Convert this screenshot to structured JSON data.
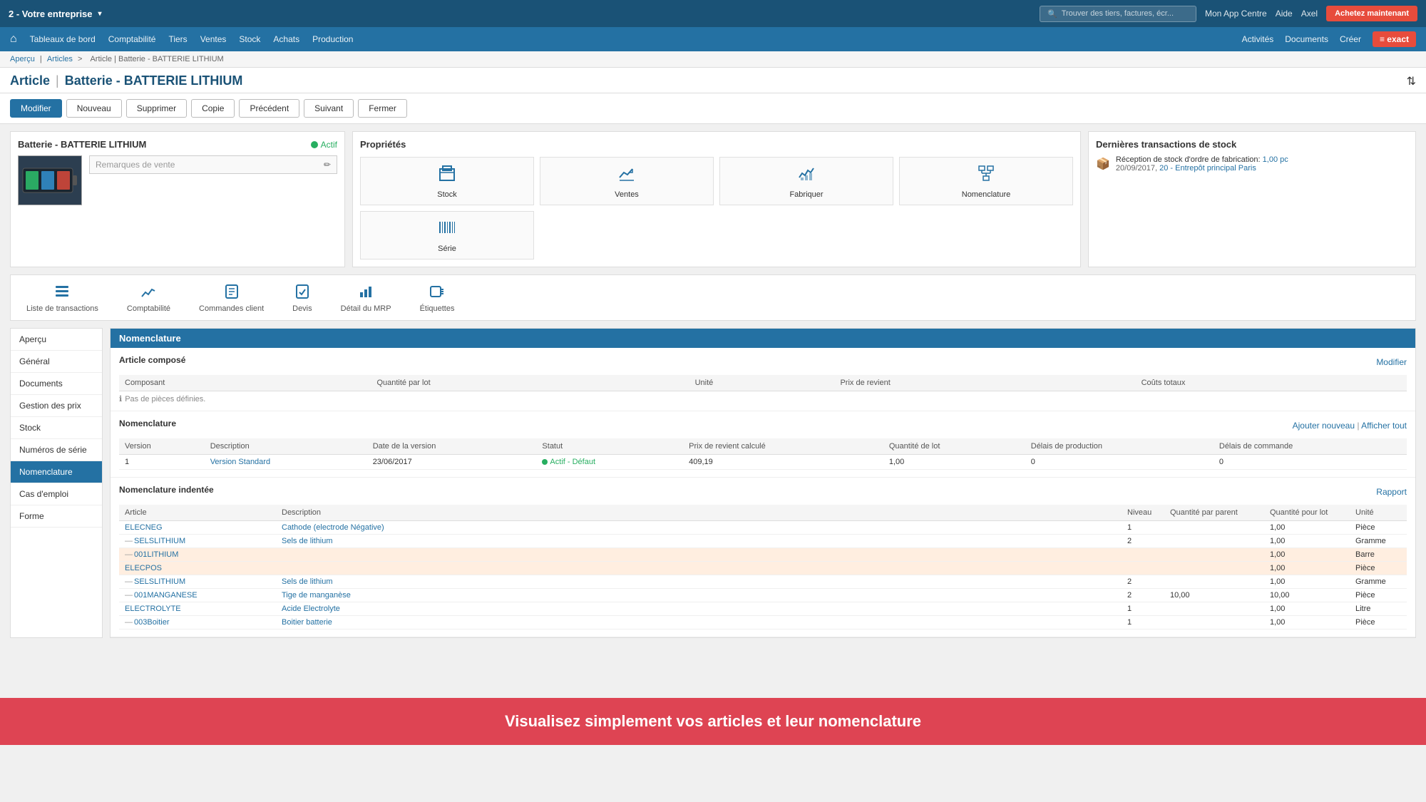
{
  "topbar": {
    "company": "2 - Votre entreprise",
    "search_placeholder": "Trouver des tiers, factures, écr...",
    "app_centre": "Mon App Centre",
    "aide": "Aide",
    "user": "Axel",
    "buy_btn": "Achetez maintenant"
  },
  "navbar": {
    "home_icon": "⌂",
    "items": [
      "Tableaux de bord",
      "Comptabilité",
      "Tiers",
      "Ventes",
      "Stock",
      "Achats",
      "Production"
    ],
    "right_links": [
      "Activités",
      "Documents",
      "Créer"
    ]
  },
  "breadcrumb": {
    "parts": [
      "Aperçu",
      "Articles",
      "Article | Batterie - BATTERIE LITHIUM"
    ]
  },
  "page": {
    "category": "Article",
    "title": "Batterie - BATTERIE LITHIUM",
    "filter_icon": "⇅"
  },
  "actions": {
    "modifier": "Modifier",
    "nouveau": "Nouveau",
    "supprimer": "Supprimer",
    "copie": "Copie",
    "precedent": "Précédent",
    "suivant": "Suivant",
    "fermer": "Fermer"
  },
  "product_panel": {
    "title": "Batterie - BATTERIE LITHIUM",
    "active_label": "Actif",
    "remarks_placeholder": "Remarques de vente"
  },
  "props_panel": {
    "title": "Propriétés",
    "items": [
      {
        "icon": "📦",
        "label": "Stock"
      },
      {
        "icon": "💰",
        "label": "Ventes"
      },
      {
        "icon": "🔧",
        "label": "Fabriquer"
      },
      {
        "icon": "📋",
        "label": "Nomenclature"
      },
      {
        "icon": "▦",
        "label": "Série"
      }
    ]
  },
  "transactions_panel": {
    "title": "Dernières transactions de stock",
    "transaction": {
      "description": "Réception de stock d'ordre de fabrication:",
      "quantity": "1,00 pc",
      "date": "20/09/2017,",
      "location_link": "20 - Entrepôt principal Paris"
    }
  },
  "tabs": [
    {
      "icon": "☰",
      "label": "Liste de transactions"
    },
    {
      "icon": "📊",
      "label": "Comptabilité"
    },
    {
      "icon": "📋",
      "label": "Commandes client"
    },
    {
      "icon": "📄",
      "label": "Devis"
    },
    {
      "icon": "📈",
      "label": "Détail du MRP"
    },
    {
      "icon": "🏷",
      "label": "Étiquettes"
    }
  ],
  "sidebar": {
    "items": [
      {
        "label": "Aperçu",
        "active": false
      },
      {
        "label": "Général",
        "active": false
      },
      {
        "label": "Documents",
        "active": false
      },
      {
        "label": "Gestion des prix",
        "active": false
      },
      {
        "label": "Stock",
        "active": false
      },
      {
        "label": "Numéros de série",
        "active": false
      },
      {
        "label": "Nomenclature",
        "active": true
      },
      {
        "label": "Cas d'emploi",
        "active": false
      },
      {
        "label": "Forme",
        "active": false
      }
    ]
  },
  "nomenclature_section": {
    "header": "Nomenclature",
    "article_compose_title": "Article composé",
    "modifier_link": "Modifier",
    "composant_col": "Composant",
    "qte_col": "Quantité par lot",
    "unite_col": "Unité",
    "prix_col": "Prix de revient",
    "cout_col": "Coûts totaux",
    "no_pieces": "Pas de pièces définies.",
    "nom_title": "Nomenclature",
    "ajouter_link": "Ajouter nouveau",
    "separator": "|",
    "afficher_link": "Afficher tout",
    "version_col": "Version",
    "description_col": "Description",
    "date_col": "Date de la version",
    "statut_col": "Statut",
    "prix_calc_col": "Prix de revient calculé",
    "qte_lot_col": "Quantité de lot",
    "delais_prod_col": "Délais de production",
    "delais_cmd_col": "Délais de commande",
    "nomenclature_rows": [
      {
        "version": "1",
        "description": "Version Standard",
        "date": "23/06/2017",
        "statut": "Actif - Défaut",
        "prix_calc": "409,19",
        "qte_lot": "1,00",
        "delais_prod": "0",
        "delais_cmd": "0"
      }
    ],
    "nom_indentee_title": "Nomenclature indentée",
    "rapport_link": "Rapport",
    "article_col": "Article",
    "description_i_col": "Description",
    "niveau_col": "Niveau",
    "qte_parent_col": "Quantité par parent",
    "qte_lot_i_col": "Quantité pour lot",
    "unite_i_col": "Unité",
    "nom_indentee_rows": [
      {
        "indent": 1,
        "article": "ELECNEG",
        "description": "Cathode (electrode Négative)",
        "niveau": "1",
        "qte_parent": "",
        "qte_lot_i": "1,00",
        "unite": "Pièce",
        "highlight": false
      },
      {
        "indent": 2,
        "article": "SELSLITHIUM",
        "description": "Sels de lithium",
        "niveau": "2",
        "qte_parent": "",
        "qte_lot_i": "1,00",
        "unite": "Gramme",
        "highlight": false
      },
      {
        "indent": 3,
        "article": "001LITHIUM",
        "description": "",
        "niveau": "",
        "qte_parent": "",
        "qte_lot_i": "1,00",
        "unite": "Barre",
        "highlight": true
      },
      {
        "indent": 1,
        "article": "ELECPOS",
        "description": "",
        "niveau": "",
        "qte_parent": "",
        "qte_lot_i": "1,00",
        "unite": "Pièce",
        "highlight": true
      },
      {
        "indent": 2,
        "article": "SELSLITHIUM",
        "description": "Sels de lithium",
        "niveau": "2",
        "qte_parent": "",
        "qte_lot_i": "1,00",
        "unite": "Gramme",
        "highlight": false
      },
      {
        "indent": 2,
        "article": "001MANGANESE",
        "description": "Tige de manganèse",
        "niveau": "2",
        "qte_parent": "10,00",
        "qte_lot_i": "10,00",
        "unite": "Pièce",
        "highlight": false
      },
      {
        "indent": 1,
        "article": "ELECTROLYTE",
        "description": "Acide Electrolyte",
        "niveau": "1",
        "qte_parent": "",
        "qte_lot_i": "1,00",
        "unite": "Litre",
        "highlight": false
      },
      {
        "indent": 2,
        "article": "003Boitier",
        "description": "Boitier batterie",
        "niveau": "1",
        "qte_parent": "",
        "qte_lot_i": "1,00",
        "unite": "Pièce",
        "highlight": false
      }
    ]
  },
  "overlay": {
    "text": "Visualisez simplement vos articles et leur nomenclature"
  }
}
